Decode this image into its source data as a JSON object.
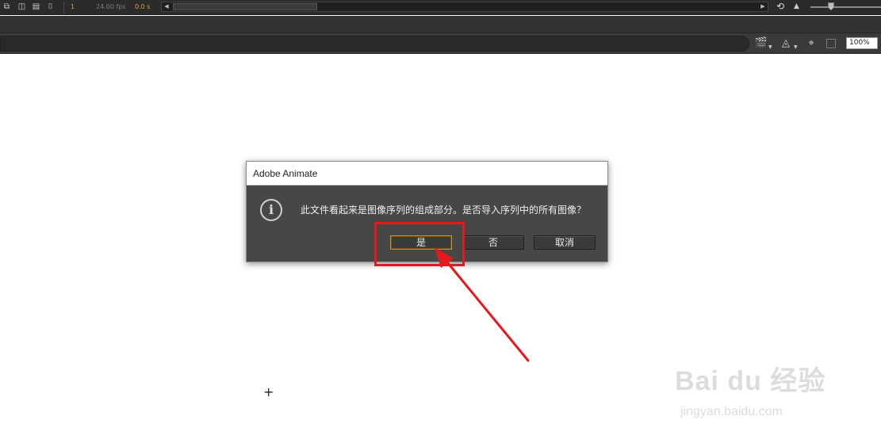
{
  "timeline": {
    "frame": "1",
    "fps": "24.00 fps",
    "time": "0.0 s",
    "icons": [
      "onion-skin-icon",
      "onion-outline-icon",
      "edit-multiple-frames-icon",
      "modify-markers-icon"
    ]
  },
  "edit_bar": {
    "zoom": "100%"
  },
  "dialog": {
    "title": "Adobe Animate",
    "message": "此文件看起来是图像序列的组成部分。是否导入序列中的所有图像？",
    "buttons": {
      "yes": "是",
      "no": "否",
      "cancel": "取消"
    },
    "icon": "info-icon"
  },
  "annotation": {
    "color": "#e3191c"
  },
  "watermark": {
    "logo": "Bai du 经验",
    "url": "jingyan.baidu.com"
  },
  "colors": {
    "dialog_bg": "#474747",
    "accent_focus": "#c8922a",
    "timeline_accent": "#d9a426"
  }
}
